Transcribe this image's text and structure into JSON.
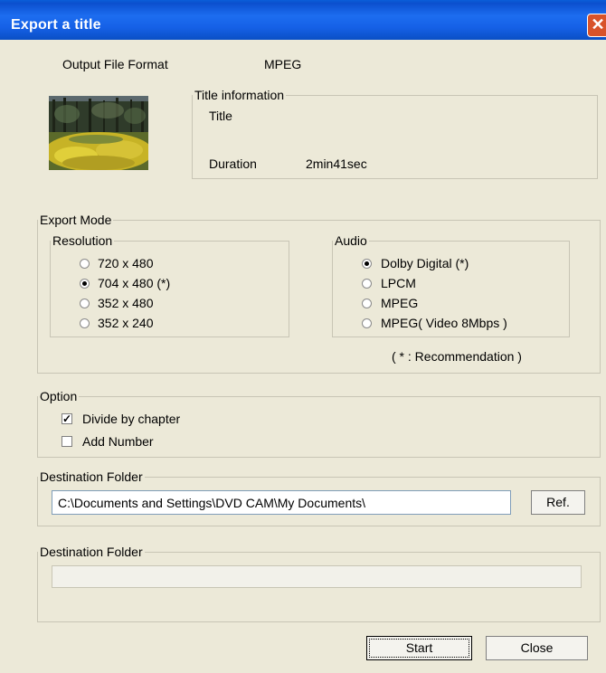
{
  "window": {
    "title": "Export a title",
    "close_glyph": "✕"
  },
  "output": {
    "label": "Output File Format",
    "value": "MPEG"
  },
  "title_info": {
    "legend": "Title information",
    "title_label": "Title",
    "duration_label": "Duration",
    "duration_value": "2min41sec"
  },
  "export_mode": {
    "legend": "Export Mode",
    "resolution": {
      "legend": "Resolution",
      "options": [
        "720 x 480",
        "704 x 480  (*)",
        "352 x 480",
        "352 x 240"
      ],
      "selected": 1
    },
    "audio": {
      "legend": "Audio",
      "options": [
        "Dolby Digital  (*)",
        "LPCM",
        "MPEG",
        "MPEG( Video 8Mbps )"
      ],
      "selected": 0
    },
    "note": "( * : Recommendation )"
  },
  "option": {
    "legend": "Option",
    "divide_label": "Divide by chapter",
    "divide_checked": true,
    "add_number_label": "Add Number",
    "add_number_checked": false
  },
  "destination": {
    "legend": "Destination Folder",
    "path": "C:\\Documents and Settings\\DVD CAM\\My Documents\\",
    "ref_label": "Ref."
  },
  "progress_group": {
    "legend": "Destination Folder"
  },
  "buttons": {
    "start": "Start",
    "close": "Close"
  },
  "colors": {
    "titlebar": "#0b4fce",
    "dialog_bg": "#ece9d8",
    "close_button": "#d8532a"
  }
}
